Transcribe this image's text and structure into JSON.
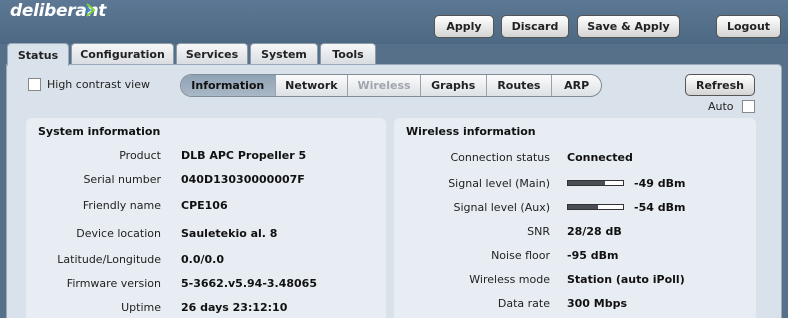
{
  "header": {
    "logo": "deliberant",
    "buttons": {
      "apply": "Apply",
      "discard": "Discard",
      "save_apply": "Save & Apply",
      "logout": "Logout"
    }
  },
  "tabs": [
    "Status",
    "Configuration",
    "Services",
    "System",
    "Tools"
  ],
  "active_tab": "Status",
  "toolbar": {
    "high_contrast": "High contrast view",
    "refresh": "Refresh",
    "auto": "Auto"
  },
  "subtabs": [
    "Information",
    "Network",
    "Wireless",
    "Graphs",
    "Routes",
    "ARP"
  ],
  "active_subtab": "Information",
  "disabled_subtab": "Wireless",
  "system": {
    "title": "System information",
    "rows": [
      {
        "label": "Product",
        "value": "DLB APC Propeller 5"
      },
      {
        "label": "Serial number",
        "value": "040D13030000007F"
      },
      {
        "label": "Friendly name",
        "value": "CPE106"
      },
      {
        "label": "Device location",
        "value": "Sauletekio al. 8"
      },
      {
        "label": "Latitude/Longitude",
        "value": "0.0/0.0"
      },
      {
        "label": "Firmware version",
        "value": "5-3662.v5.94-3.48065"
      },
      {
        "label": "Uptime",
        "value": "26 days 23:12:10"
      }
    ]
  },
  "wireless": {
    "title": "Wireless information",
    "rows": [
      {
        "label": "Connection status",
        "value": "Connected"
      },
      {
        "label": "Signal level (Main)",
        "value": "-49 dBm",
        "meter": 0.68
      },
      {
        "label": "Signal level (Aux)",
        "value": "-54 dBm",
        "meter": 0.55
      },
      {
        "label": "SNR",
        "value": "28/28 dB"
      },
      {
        "label": "Noise floor",
        "value": "-95 dBm"
      },
      {
        "label": "Wireless mode",
        "value": "Station (auto iPoll)"
      },
      {
        "label": "Data rate",
        "value": "300 Mbps"
      }
    ]
  }
}
